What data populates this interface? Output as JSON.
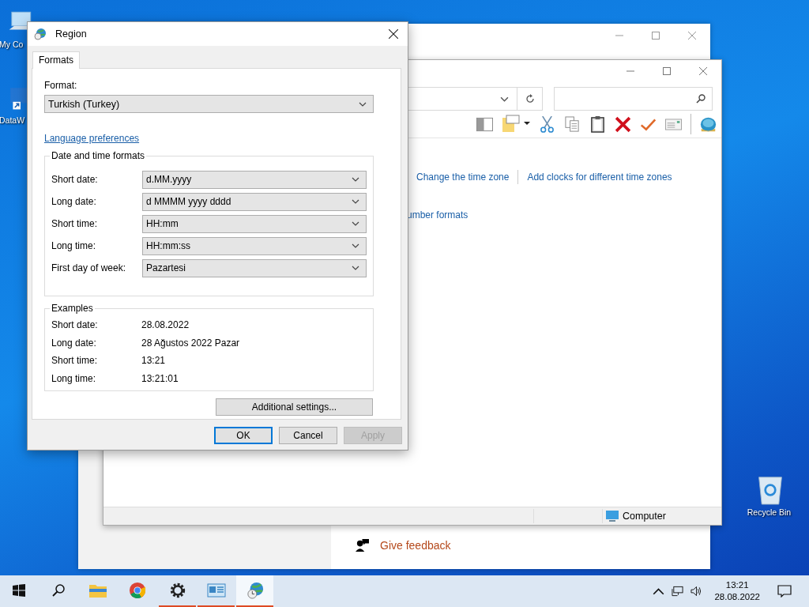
{
  "desktop_icons": [
    {
      "kind": "computer",
      "label": "My Co"
    },
    {
      "kind": "shortcut",
      "label": "DataW"
    },
    {
      "kind": "recycle",
      "label": "Recycle Bin"
    }
  ],
  "back_window": {
    "feedback_link": "Give feedback"
  },
  "explorer_window": {
    "links": [
      "Change the time zone",
      "Add clocks for different time zones"
    ],
    "cut_link": "umber formats",
    "status_bar": "Computer"
  },
  "dialog": {
    "title": "Region",
    "tabs": [
      {
        "label": "Formats",
        "selected": true
      }
    ],
    "format_label": "Format:",
    "format_value": "Turkish (Turkey)",
    "language_link": "Language preferences",
    "date_time_group": {
      "title": "Date and time formats",
      "rows": [
        {
          "label": "Short date:",
          "value": "d.MM.yyyy"
        },
        {
          "label": "Long date:",
          "value": "d MMMM yyyy dddd"
        },
        {
          "label": "Short time:",
          "value": "HH:mm"
        },
        {
          "label": "Long time:",
          "value": "HH:mm:ss"
        },
        {
          "label": "First day of week:",
          "value": "Pazartesi"
        }
      ]
    },
    "examples": {
      "title": "Examples",
      "rows": [
        {
          "label": "Short date:",
          "value": "28.08.2022"
        },
        {
          "label": "Long date:",
          "value": "28 Ağustos 2022 Pazar"
        },
        {
          "label": "Short time:",
          "value": "13:21"
        },
        {
          "label": "Long time:",
          "value": "13:21:01"
        }
      ]
    },
    "additional_button": "Additional settings...",
    "buttons": [
      {
        "label": "OK",
        "default": true,
        "disabled": false
      },
      {
        "label": "Cancel",
        "default": false,
        "disabled": false
      },
      {
        "label": "Apply",
        "default": false,
        "disabled": true
      }
    ]
  },
  "taskbar": {
    "apps": [
      {
        "kind": "folder",
        "running": false,
        "active": false
      },
      {
        "kind": "chrome",
        "running": false,
        "active": false
      },
      {
        "kind": "settings",
        "running": true,
        "active": false
      },
      {
        "kind": "control-panel",
        "running": true,
        "active": false
      },
      {
        "kind": "region",
        "running": true,
        "active": true
      }
    ],
    "time": "13:21",
    "date": "28.08.2022"
  }
}
